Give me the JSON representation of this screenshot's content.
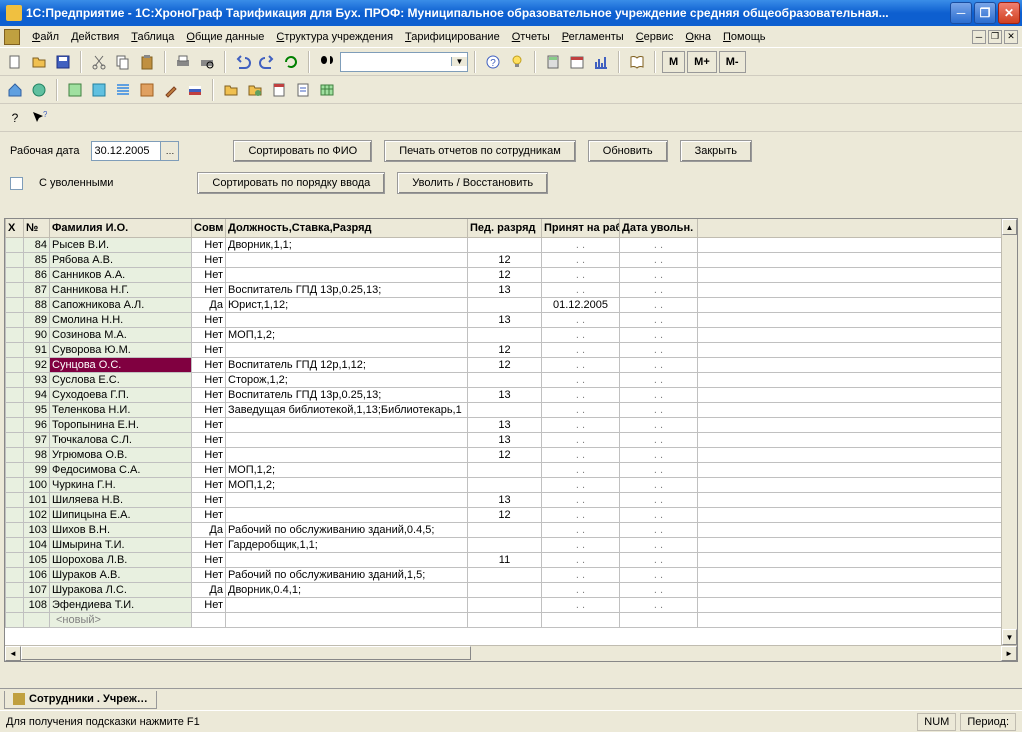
{
  "window": {
    "title": "1С:Предприятие - 1С:ХроноГраф Тарификация для Бух. ПРОФ: Муниципальное образовательное учреждение средняя общеобразовательная..."
  },
  "menu": [
    "Файл",
    "Действия",
    "Таблица",
    "Общие данные",
    "Структура учреждения",
    "Тарифицирование",
    "Отчеты",
    "Регламенты",
    "Сервис",
    "Окна",
    "Помощь"
  ],
  "panel": {
    "date_label": "Рабочая дата",
    "date_value": "30.12.2005",
    "sort_fio": "Сортировать по ФИО",
    "print_reports": "Печать отчетов по сотрудникам",
    "refresh": "Обновить",
    "close": "Закрыть",
    "with_fired": "С уволенными",
    "sort_input": "Сортировать по порядку ввода",
    "fire_restore": "Уволить / Восстановить"
  },
  "grid": {
    "headers": {
      "x": "Х",
      "num": "№",
      "name": "Фамилия И.О.",
      "sovm": "Совм",
      "position": "Должность,Ставка,Разряд",
      "ped": "Пед. разряд",
      "hired": "Принят на раб.",
      "fired": "Дата увольн."
    },
    "new_label": "<новый>",
    "rows": [
      {
        "num": "84",
        "name": "Рысев В.И.",
        "sovm": "Нет",
        "pos": "Дворник,1,1;",
        "ped": "",
        "hired": ". .",
        "fired": ". ."
      },
      {
        "num": "85",
        "name": "Рябова А.В.",
        "sovm": "Нет",
        "pos": "",
        "ped": "12",
        "hired": ". .",
        "fired": ". ."
      },
      {
        "num": "86",
        "name": "Санников А.А.",
        "sovm": "Нет",
        "pos": "",
        "ped": "12",
        "hired": ". .",
        "fired": ". ."
      },
      {
        "num": "87",
        "name": "Санникова Н.Г.",
        "sovm": "Нет",
        "pos": "Воспитатель ГПД 13р,0.25,13;",
        "ped": "13",
        "hired": ". .",
        "fired": ". ."
      },
      {
        "num": "88",
        "name": "Сапожникова А.Л.",
        "sovm": "Да",
        "pos": "Юрист,1,12;",
        "ped": "",
        "hired": "01.12.2005",
        "fired": ". ."
      },
      {
        "num": "89",
        "name": "Смолина Н.Н.",
        "sovm": "Нет",
        "pos": "",
        "ped": "13",
        "hired": ". .",
        "fired": ". ."
      },
      {
        "num": "90",
        "name": "Созинова М.А.",
        "sovm": "Нет",
        "pos": "МОП,1,2;",
        "ped": "",
        "hired": ". .",
        "fired": ". ."
      },
      {
        "num": "91",
        "name": "Суворова Ю.М.",
        "sovm": "Нет",
        "pos": "",
        "ped": "12",
        "hired": ". .",
        "fired": ". ."
      },
      {
        "num": "92",
        "name": "Сунцова О.С.",
        "sovm": "Нет",
        "pos": "Воспитатель ГПД 12р,1,12;",
        "ped": "12",
        "hired": ". .",
        "fired": ". .",
        "selected": true
      },
      {
        "num": "93",
        "name": "Суслова Е.С.",
        "sovm": "Нет",
        "pos": "Сторож,1,2;",
        "ped": "",
        "hired": ". .",
        "fired": ". ."
      },
      {
        "num": "94",
        "name": "Суходоева Г.П.",
        "sovm": "Нет",
        "pos": "Воспитатель ГПД 13р,0.25,13;",
        "ped": "13",
        "hired": ". .",
        "fired": ". ."
      },
      {
        "num": "95",
        "name": "Теленкова Н.И.",
        "sovm": "Нет",
        "pos": "Заведущая библиотекой,1,13;Библиотекарь,1",
        "ped": "",
        "hired": ". .",
        "fired": ". ."
      },
      {
        "num": "96",
        "name": "Торопынина Е.Н.",
        "sovm": "Нет",
        "pos": "",
        "ped": "13",
        "hired": ". .",
        "fired": ". ."
      },
      {
        "num": "97",
        "name": "Тючкалова С.Л.",
        "sovm": "Нет",
        "pos": "",
        "ped": "13",
        "hired": ". .",
        "fired": ". ."
      },
      {
        "num": "98",
        "name": "Угрюмова О.В.",
        "sovm": "Нет",
        "pos": "",
        "ped": "12",
        "hired": ". .",
        "fired": ". ."
      },
      {
        "num": "99",
        "name": "Федосимова С.А.",
        "sovm": "Нет",
        "pos": "МОП,1,2;",
        "ped": "",
        "hired": ". .",
        "fired": ". ."
      },
      {
        "num": "100",
        "name": "Чуркина Г.Н.",
        "sovm": "Нет",
        "pos": "МОП,1,2;",
        "ped": "",
        "hired": ". .",
        "fired": ". ."
      },
      {
        "num": "101",
        "name": "Шиляева Н.В.",
        "sovm": "Нет",
        "pos": "",
        "ped": "13",
        "hired": ". .",
        "fired": ". ."
      },
      {
        "num": "102",
        "name": "Шипицына Е.А.",
        "sovm": "Нет",
        "pos": "",
        "ped": "12",
        "hired": ". .",
        "fired": ". ."
      },
      {
        "num": "103",
        "name": "Шихов В.Н.",
        "sovm": "Да",
        "pos": "Рабочий по обслуживанию зданий,0.4,5;",
        "ped": "",
        "hired": ". .",
        "fired": ". ."
      },
      {
        "num": "104",
        "name": "Шмырина Т.И.",
        "sovm": "Нет",
        "pos": "Гардеробщик,1,1;",
        "ped": "",
        "hired": ". .",
        "fired": ". ."
      },
      {
        "num": "105",
        "name": "Шорохова Л.В.",
        "sovm": "Нет",
        "pos": "",
        "ped": "11",
        "hired": ". .",
        "fired": ". ."
      },
      {
        "num": "106",
        "name": "Шураков А.В.",
        "sovm": "Нет",
        "pos": "Рабочий по обслуживанию зданий,1,5;",
        "ped": "",
        "hired": ". .",
        "fired": ". ."
      },
      {
        "num": "107",
        "name": "Шуракова Л.С.",
        "sovm": "Да",
        "pos": "Дворник,0.4,1;",
        "ped": "",
        "hired": ". .",
        "fired": ". ."
      },
      {
        "num": "108",
        "name": "Эфендиева Т.И.",
        "sovm": "Нет",
        "pos": "",
        "ped": "",
        "hired": ". .",
        "fired": ". ."
      }
    ]
  },
  "tab": {
    "label": "Сотрудники . Учреж…"
  },
  "status": {
    "hint": "Для получения подсказки нажмите F1",
    "num": "NUM",
    "period": "Период:"
  },
  "toolbar_text": {
    "m": "М",
    "mplus": "М+",
    "mminus": "М-"
  }
}
